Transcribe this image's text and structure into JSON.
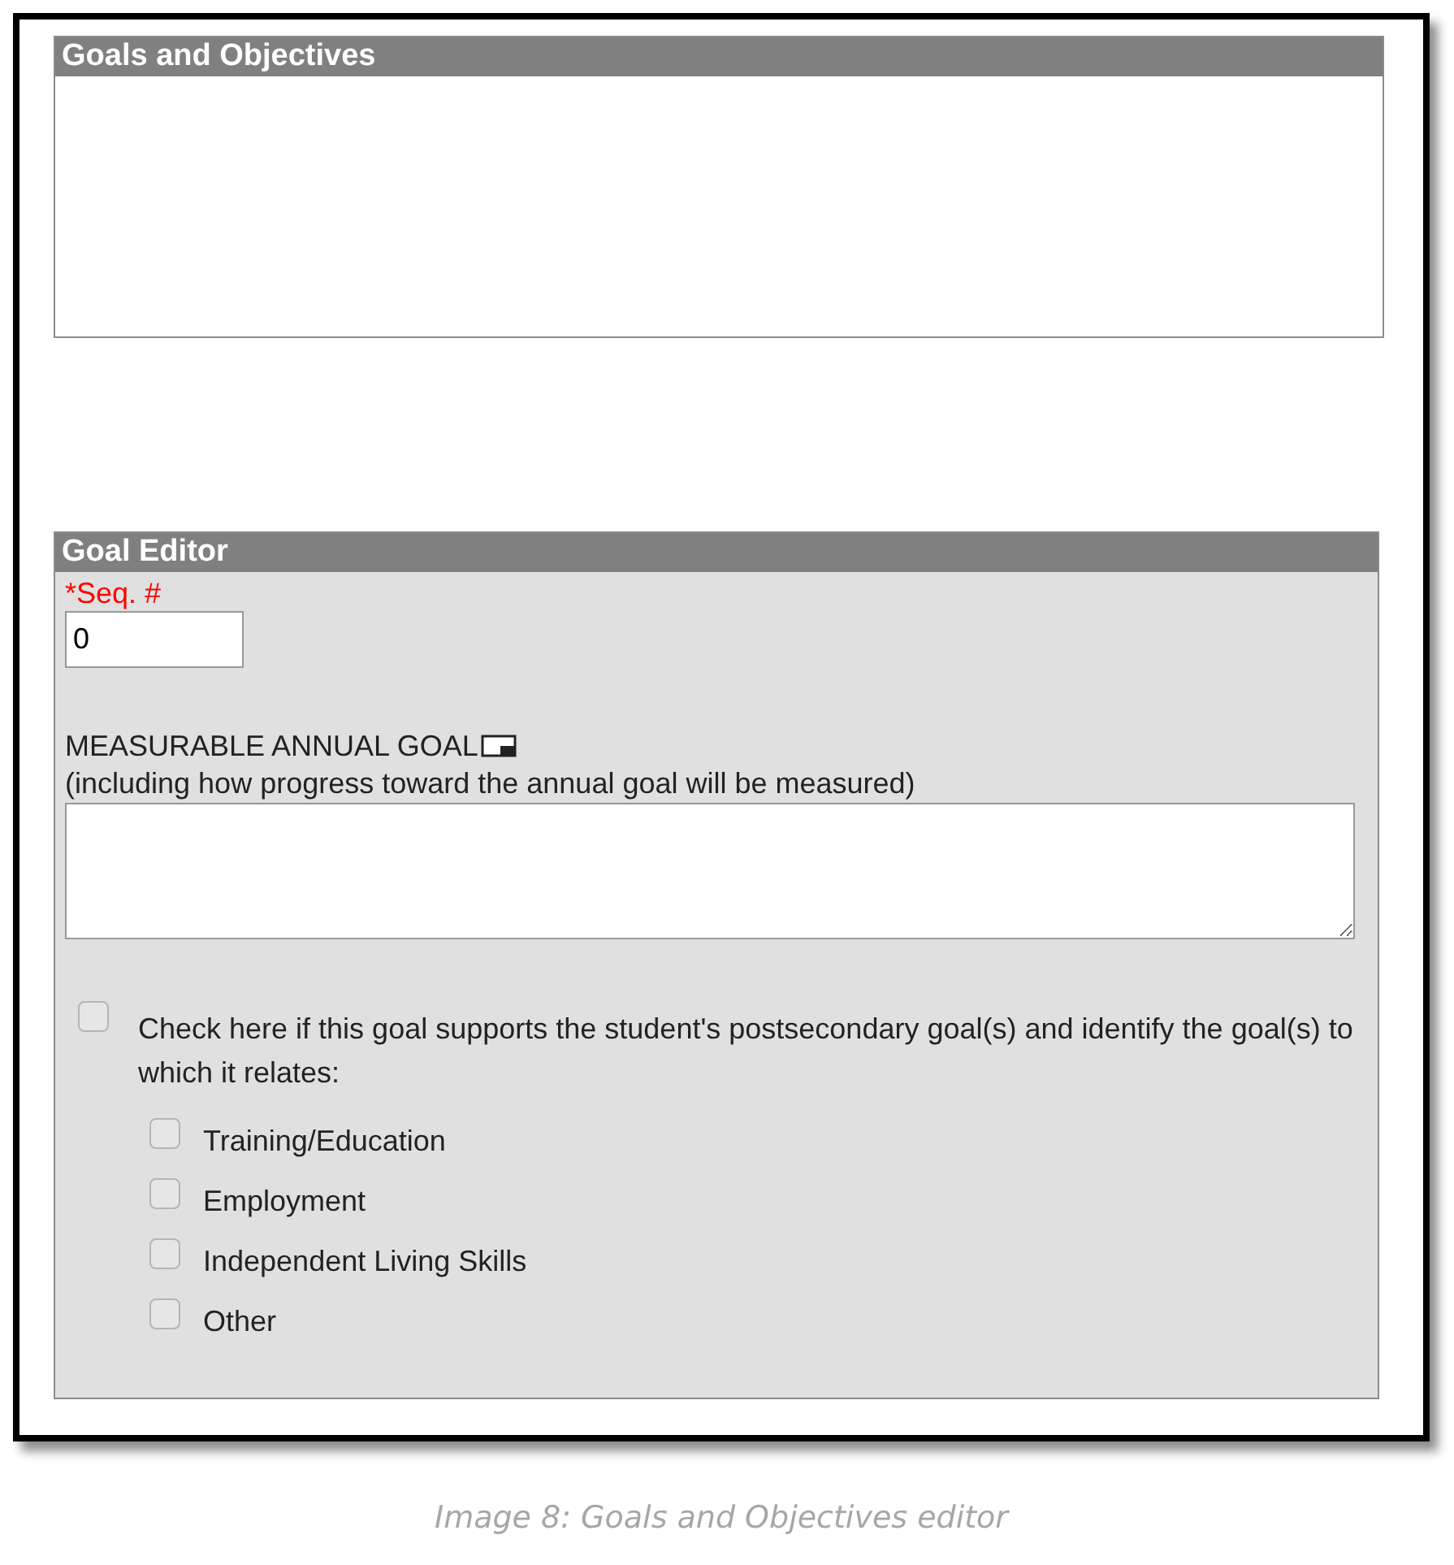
{
  "goals_panel": {
    "title": "Goals and Objectives"
  },
  "goal_editor": {
    "title": "Goal Editor",
    "seq_label": "*Seq. #",
    "seq_value": "0",
    "goal_label": "MEASURABLE ANNUAL GOAL",
    "goal_hint": "(including how progress toward the annual goal will be measured)",
    "supports_check": {
      "label": "Check here if this goal supports the student's postsecondary goal(s) and identify the goal(s) to which it relates:",
      "checked": false
    },
    "postsecondary_goals": [
      {
        "label": "Training/Education",
        "checked": false
      },
      {
        "label": "Employment",
        "checked": false
      },
      {
        "label": "Independent Living Skills",
        "checked": false
      },
      {
        "label": "Other",
        "checked": false
      }
    ]
  },
  "caption": "Image 8: Goals and Objectives editor"
}
